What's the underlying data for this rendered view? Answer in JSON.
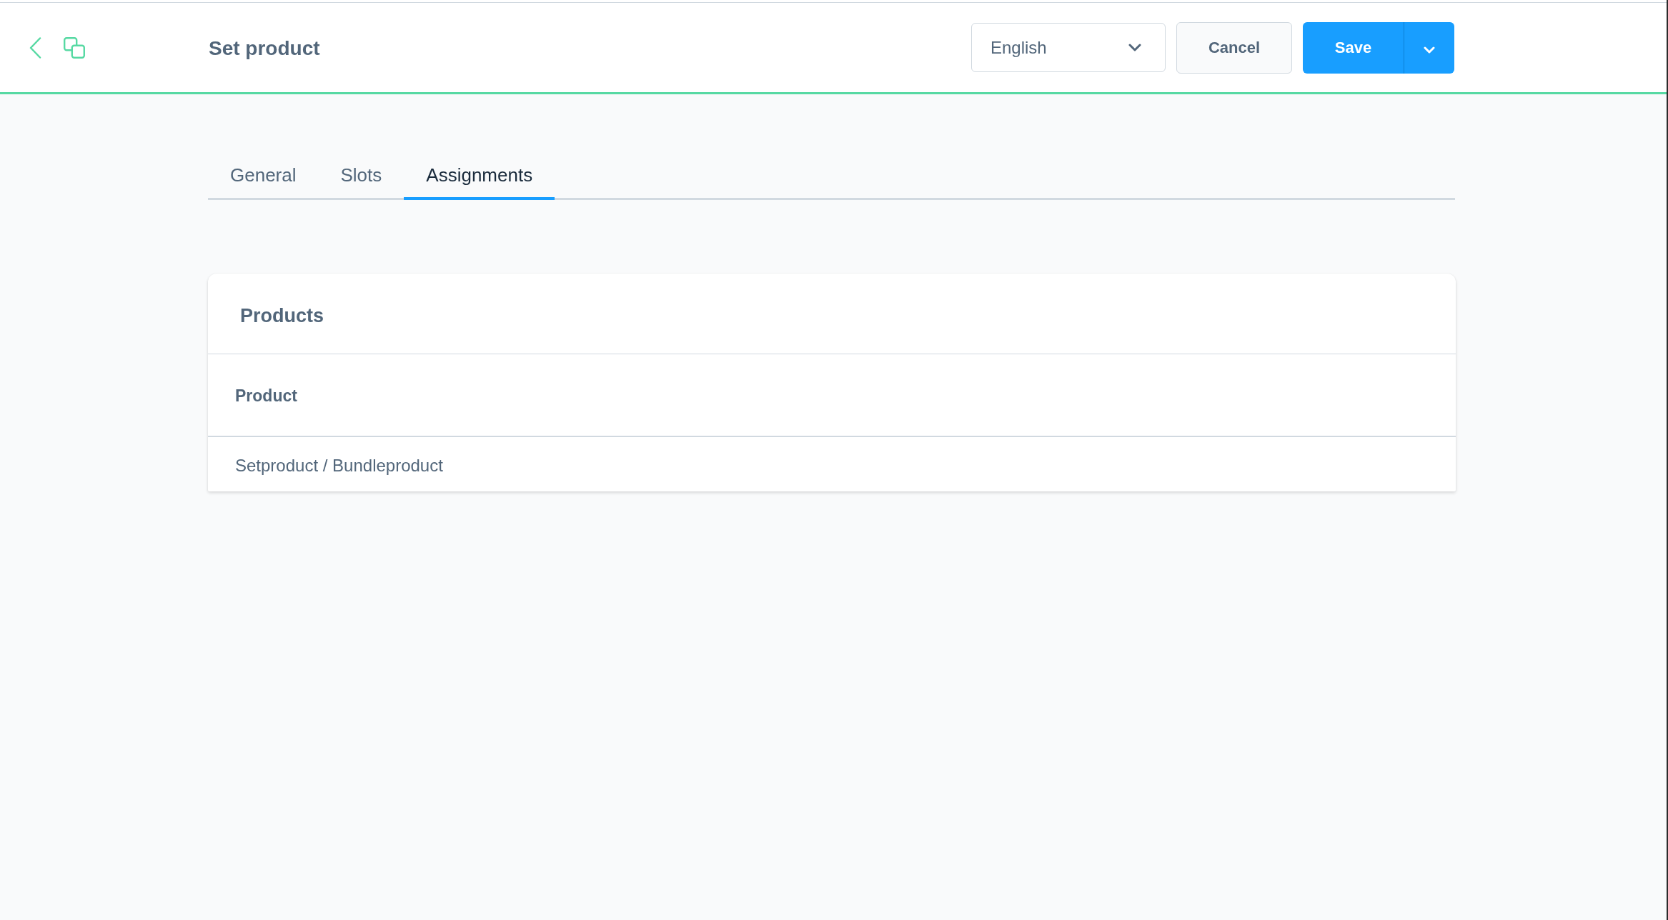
{
  "toolbar": {
    "title": "Set product",
    "language": {
      "value": "English"
    },
    "buttons": [
      {
        "label": "Cancel",
        "kind": "secondary",
        "split": false
      },
      {
        "label": "Save",
        "kind": "primary",
        "split": true
      }
    ]
  },
  "tabs": [
    {
      "label": "General",
      "selected": false
    },
    {
      "label": "Slots",
      "selected": false
    },
    {
      "label": "Assignments",
      "selected": true
    }
  ],
  "card": {
    "title": "Products",
    "table": {
      "columns": [
        "Product"
      ],
      "rows": [
        [
          "Setproduct / Bundleproduct"
        ]
      ]
    }
  }
}
